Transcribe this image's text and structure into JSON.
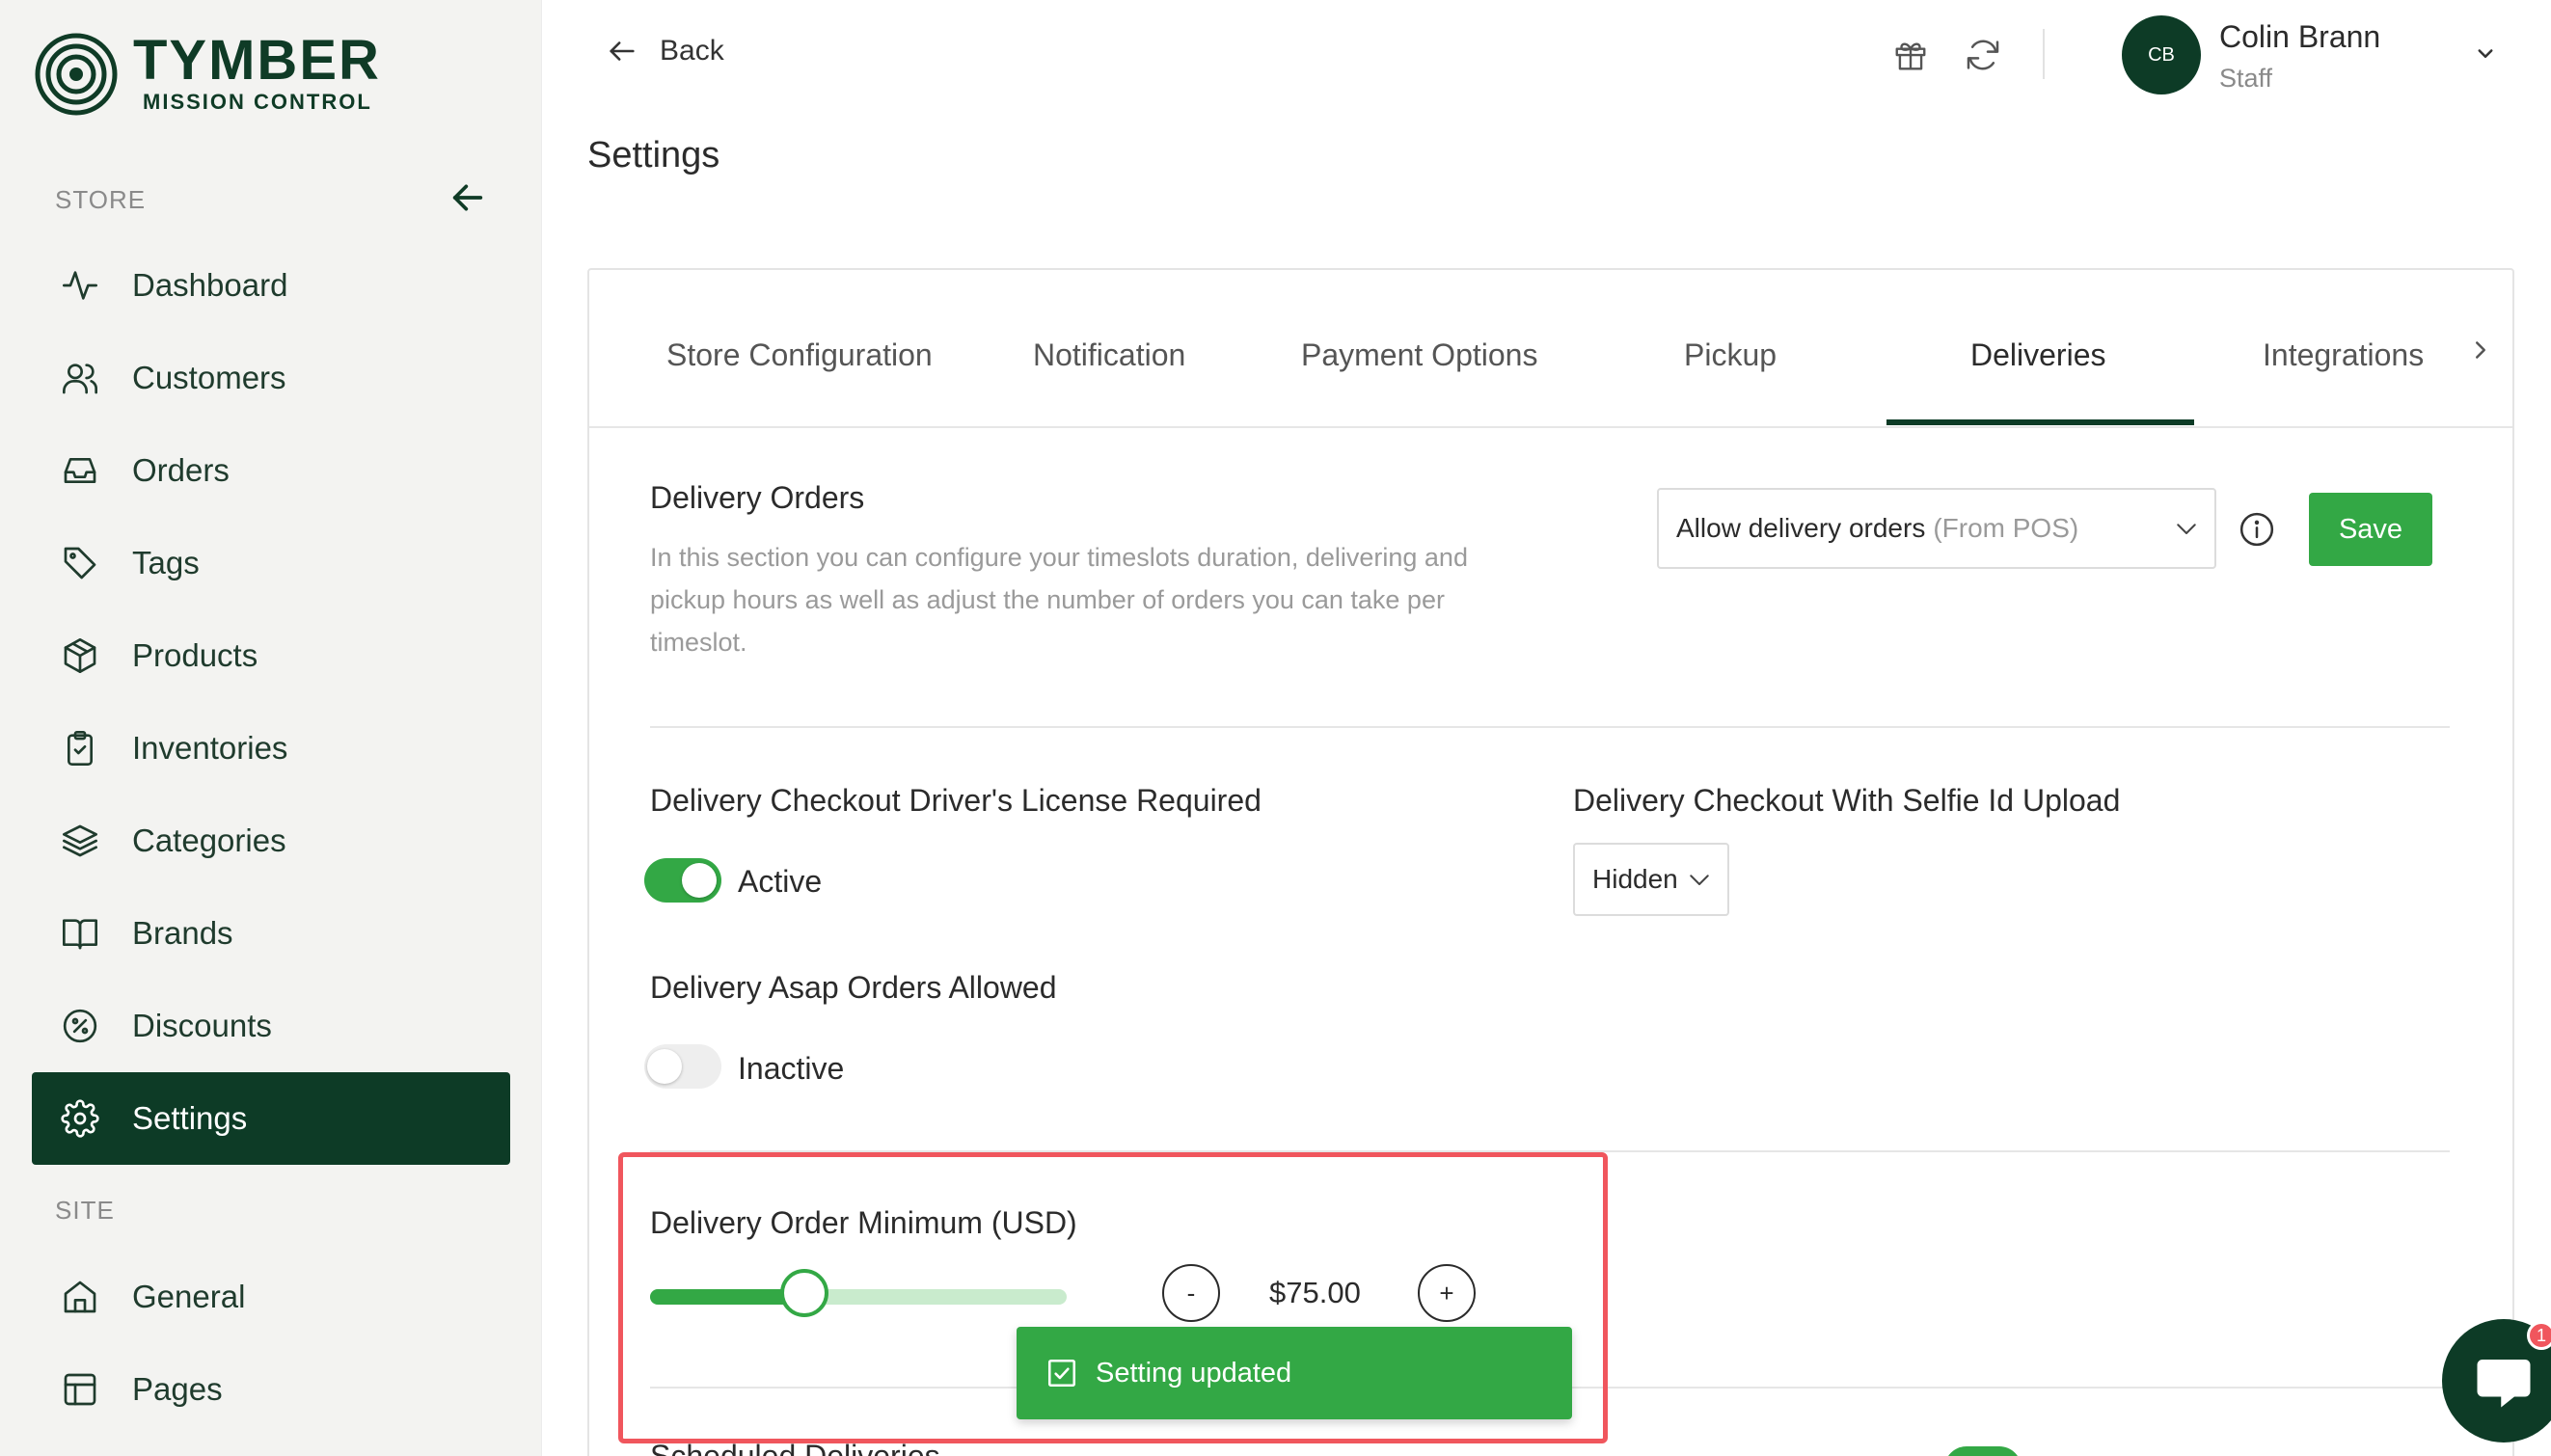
{
  "brand": {
    "title": "TYMBER",
    "subtitle": "MISSION CONTROL"
  },
  "sidebar": {
    "store_label": "STORE",
    "site_label": "SITE",
    "store_items": [
      {
        "label": "Dashboard",
        "icon": "activity-icon"
      },
      {
        "label": "Customers",
        "icon": "users-icon"
      },
      {
        "label": "Orders",
        "icon": "inbox-icon"
      },
      {
        "label": "Tags",
        "icon": "tag-icon"
      },
      {
        "label": "Products",
        "icon": "box-icon"
      },
      {
        "label": "Inventories",
        "icon": "clipboard-check-icon"
      },
      {
        "label": "Categories",
        "icon": "layers-icon"
      },
      {
        "label": "Brands",
        "icon": "book-open-icon"
      },
      {
        "label": "Discounts",
        "icon": "percent-icon"
      },
      {
        "label": "Settings",
        "icon": "gear-icon",
        "active": true
      }
    ],
    "site_items": [
      {
        "label": "General",
        "icon": "home-icon"
      },
      {
        "label": "Pages",
        "icon": "layout-icon"
      }
    ]
  },
  "topbar": {
    "back_label": "Back",
    "user": {
      "initials": "CB",
      "name": "Colin Brann",
      "role": "Staff"
    }
  },
  "page": {
    "title": "Settings"
  },
  "tabs": [
    {
      "label": "Store Configuration"
    },
    {
      "label": "Notification"
    },
    {
      "label": "Payment Options"
    },
    {
      "label": "Pickup"
    },
    {
      "label": "Deliveries",
      "active": true
    },
    {
      "label": "Integrations"
    }
  ],
  "delivery_orders": {
    "title": "Delivery Orders",
    "description": "In this section you can configure your timeslots duration, delivering and pickup hours as well as adjust the number of orders you can take per timeslot.",
    "select_value": "Allow delivery orders",
    "select_hint": "(From POS)",
    "save_label": "Save"
  },
  "license_required": {
    "title": "Delivery Checkout Driver's License Required",
    "toggle_on": true,
    "status": "Active"
  },
  "selfie_upload": {
    "title": "Delivery Checkout With Selfie Id Upload",
    "value": "Hidden"
  },
  "asap_orders": {
    "title": "Delivery Asap Orders Allowed",
    "toggle_on": false,
    "status": "Inactive"
  },
  "order_minimum": {
    "title": "Delivery Order Minimum (USD)",
    "slider_fraction": 0.37,
    "amount": "$75.00",
    "decrement_label": "-",
    "increment_label": "+"
  },
  "next_section_title": "Scheduled Deliveries",
  "toast": {
    "message": "Setting updated"
  },
  "chat": {
    "badge": "1"
  },
  "colors": {
    "brand_dark": "#0d3b26",
    "accent_green": "#33a845",
    "highlight_red": "#f0565d"
  }
}
